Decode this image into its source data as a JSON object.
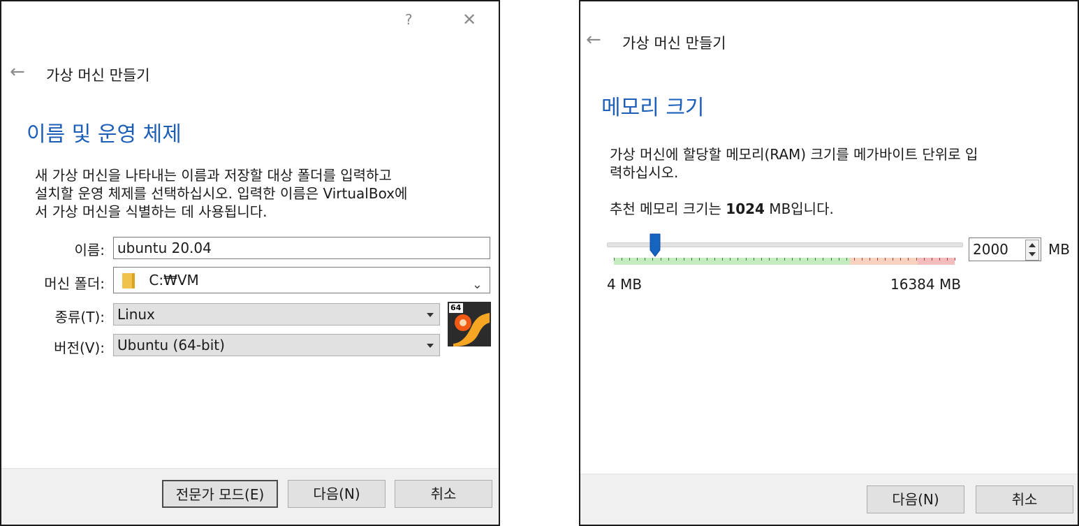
{
  "dialog1": {
    "help_glyph": "?",
    "close_glyph": "✕",
    "back_glyph": "←",
    "wizard_title": "가상 머신 만들기",
    "heading": "이름 및 운영 체제",
    "description_lines": [
      "새 가상 머신을 나타내는 이름과 저장할 대상 폴더를 입력하고",
      "설치할 운영 체제를 선택하십시오. 입력한 이름은 VirtualBox에",
      "서 가상 머신을 식별하는 데 사용됩니다."
    ],
    "name_label": "이름:",
    "name_value": "ubuntu 20.04",
    "folder_label": "머신 폴더:",
    "folder_value": "C:₩VM",
    "type_label": "종류(T):",
    "type_value": "Linux",
    "version_label": "버전(V):",
    "version_value": "Ubuntu (64-bit)",
    "os_badge": "64",
    "buttons": {
      "expert": "전문가 모드(E)",
      "next": "다음(N)",
      "cancel": "취소"
    }
  },
  "dialog2": {
    "back_glyph": "←",
    "wizard_title": "가상 머신 만들기",
    "heading": "메모리 크기",
    "description_lines": [
      "가상 머신에 할당할 메모리(RAM) 크기를 메가바이트 단위로 입",
      "력하십시오."
    ],
    "recommend_prefix": "추천 메모리 크기는 ",
    "recommend_value": "1024",
    "recommend_suffix": " MB입니다.",
    "memory_value": "2000",
    "memory_unit": "MB",
    "slider_min_label": "4 MB",
    "slider_max_label": "16384 MB",
    "slider_value_mb": 2000,
    "slider_min_mb": 4,
    "slider_max_mb": 16384,
    "buttons": {
      "next": "다음(N)",
      "cancel": "취소"
    }
  },
  "colors": {
    "heading": "#1d5fb8",
    "slider_handle": "#1565c0",
    "scale_green": "#c4ecc0",
    "scale_orange": "#f7d2c0",
    "scale_red": "#f4bcbc"
  }
}
